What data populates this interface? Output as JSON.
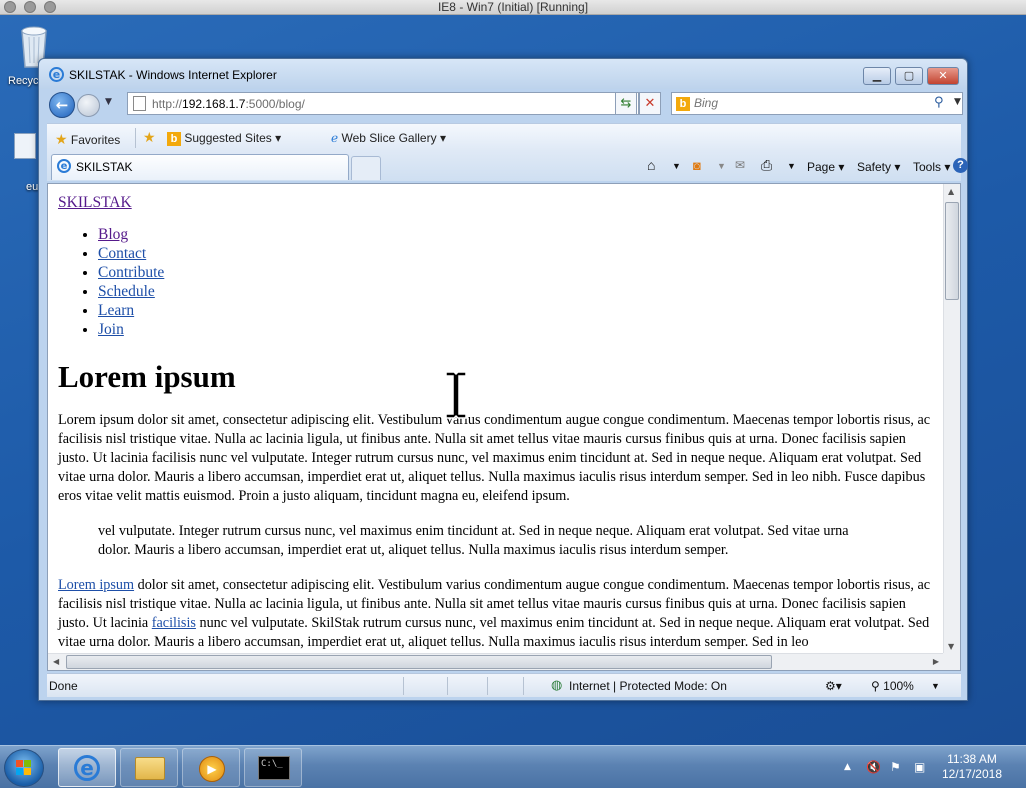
{
  "host": {
    "title": "IE8 - Win7 (Initial) [Running]"
  },
  "desktop": {
    "recycle_label": "Recyc",
    "shortcut_label": "eu"
  },
  "browser": {
    "window_title": "SKILSTAK - Windows Internet Explorer",
    "address": {
      "prefix": "http://",
      "host": "192.168.1.7",
      "rest": ":5000/blog/"
    },
    "search": {
      "placeholder": "Bing"
    },
    "favorites": {
      "favorites_label": "Favorites",
      "suggested_label": "Suggested Sites",
      "webslice_label": "Web Slice Gallery"
    },
    "tab": {
      "label": "SKILSTAK"
    },
    "commands": {
      "page": "Page",
      "safety": "Safety",
      "tools": "Tools"
    },
    "status": {
      "left": "Done",
      "zone": "Internet | Protected Mode: On",
      "zoom": "100%"
    }
  },
  "page": {
    "site_name": "SKILSTAK",
    "nav": [
      {
        "label": "Blog"
      },
      {
        "label": "Contact"
      },
      {
        "label": "Contribute"
      },
      {
        "label": "Schedule"
      },
      {
        "label": "Learn"
      },
      {
        "label": "Join"
      }
    ],
    "heading": "Lorem ipsum",
    "para1": "Lorem ipsum dolor sit amet, consectetur adipiscing elit. Vestibulum varius condimentum augue congue condimentum. Maecenas tempor lobortis risus, ac facilisis nisl tristique vitae. Nulla ac lacinia ligula, ut finibus ante. Nulla sit amet tellus vitae mauris cursus finibus quis at urna. Donec facilisis sapien justo. Ut lacinia facilisis nunc vel vulputate. Integer rutrum cursus nunc, vel maximus enim tincidunt at. Sed in neque neque. Aliquam erat volutpat. Sed vitae urna dolor. Mauris a libero accumsan, imperdiet erat ut, aliquet tellus. Nulla maximus iaculis risus interdum semper. Sed in leo nibh. Fusce dapibus eros vitae velit mattis euismod. Proin a justo aliquam, tincidunt magna eu, eleifend ipsum.",
    "quote": "vel vulputate. Integer rutrum cursus nunc, vel maximus enim tincidunt at. Sed in neque neque. Aliquam erat volutpat. Sed vitae urna dolor. Mauris a libero accumsan, imperdiet erat ut, aliquet tellus. Nulla maximus iaculis risus interdum semper.",
    "para2": {
      "link1": "Lorem ipsum",
      "text1": " dolor sit amet, consectetur adipiscing elit. Vestibulum varius condimentum augue congue condimentum. Maecenas tempor lobortis risus, ac facilisis nisl tristique vitae. Nulla ac lacinia ligula, ut finibus ante. Nulla sit amet tellus vitae mauris cursus finibus quis at urna. Donec facilisis sapien justo. Ut lacinia ",
      "link2": "facilisis",
      "text2": " nunc vel vulputate. SkilStak rutrum cursus nunc, vel maximus enim tincidunt at. Sed in neque neque. Aliquam erat volutpat. Sed vitae urna dolor. Mauris a libero accumsan, imperdiet erat ut, aliquet tellus. Nulla maximus iaculis risus interdum semper. Sed in leo"
    }
  },
  "taskbar": {
    "time": "11:38 AM",
    "date": "12/17/2018"
  }
}
